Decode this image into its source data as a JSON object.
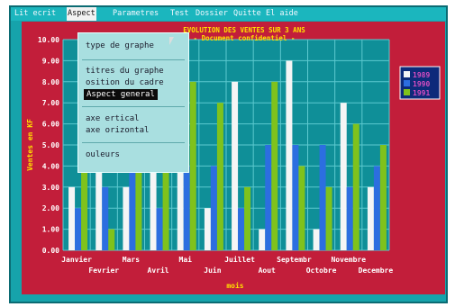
{
  "menubar": {
    "items": [
      "Lit ecrit",
      "Aspect",
      "Parametres",
      "Test",
      "Dossier",
      "Quitte",
      "El aide"
    ],
    "active": "Aspect"
  },
  "dropdown": {
    "items": [
      {
        "label": "type de graphe",
        "selected": false
      },
      {
        "label": "titres du graphe",
        "selected": false
      },
      {
        "label": "osition du cadre",
        "selected": false
      },
      {
        "label": "Aspect general",
        "selected": true
      },
      {
        "label": "axe ertical",
        "selected": false
      },
      {
        "label": "axe orizontal",
        "selected": false
      },
      {
        "label": "ouleurs",
        "selected": false
      }
    ]
  },
  "colors": {
    "screen_bg": "#16a3ab",
    "panel_bg": "#c21e3a",
    "plot_bg": "#0f8f98",
    "grid": "#5cc9cf",
    "title": "#ffe000",
    "series_1989": "#f5f5f5",
    "series_1990": "#2c6ee0",
    "series_1991": "#7fc21c"
  },
  "chart_data": {
    "type": "bar",
    "title": "EVOLUTION DES VENTES SUR 3 ANS",
    "subtitle": "- Document confidentiel -",
    "ylabel": "Ventes en KF",
    "xlabel": "mois",
    "ylim": [
      0,
      10
    ],
    "yticks": [
      "0.00",
      "1.00",
      "2.00",
      "3.00",
      "4.00",
      "5.00",
      "6.00",
      "7.00",
      "8.00",
      "9.00",
      "10.00"
    ],
    "categories": [
      "Janvier",
      "Fevrier",
      "Mars",
      "Avril",
      "Mai",
      "Juin",
      "Juillet",
      "Aout",
      "Septembr",
      "Octobre",
      "Novembre",
      "Decembre"
    ],
    "series": [
      {
        "name": "1989",
        "values": [
          3,
          4,
          3,
          5,
          5,
          2,
          8,
          1,
          9,
          1,
          7,
          3
        ]
      },
      {
        "name": "1990",
        "values": [
          2,
          3,
          4,
          2,
          4,
          4,
          2,
          5,
          5,
          5,
          3,
          4
        ]
      },
      {
        "name": "1991",
        "values": [
          5,
          1,
          4,
          4,
          8,
          7,
          3,
          8,
          4,
          3,
          6,
          5
        ]
      }
    ],
    "grid": true,
    "legend": "right"
  }
}
